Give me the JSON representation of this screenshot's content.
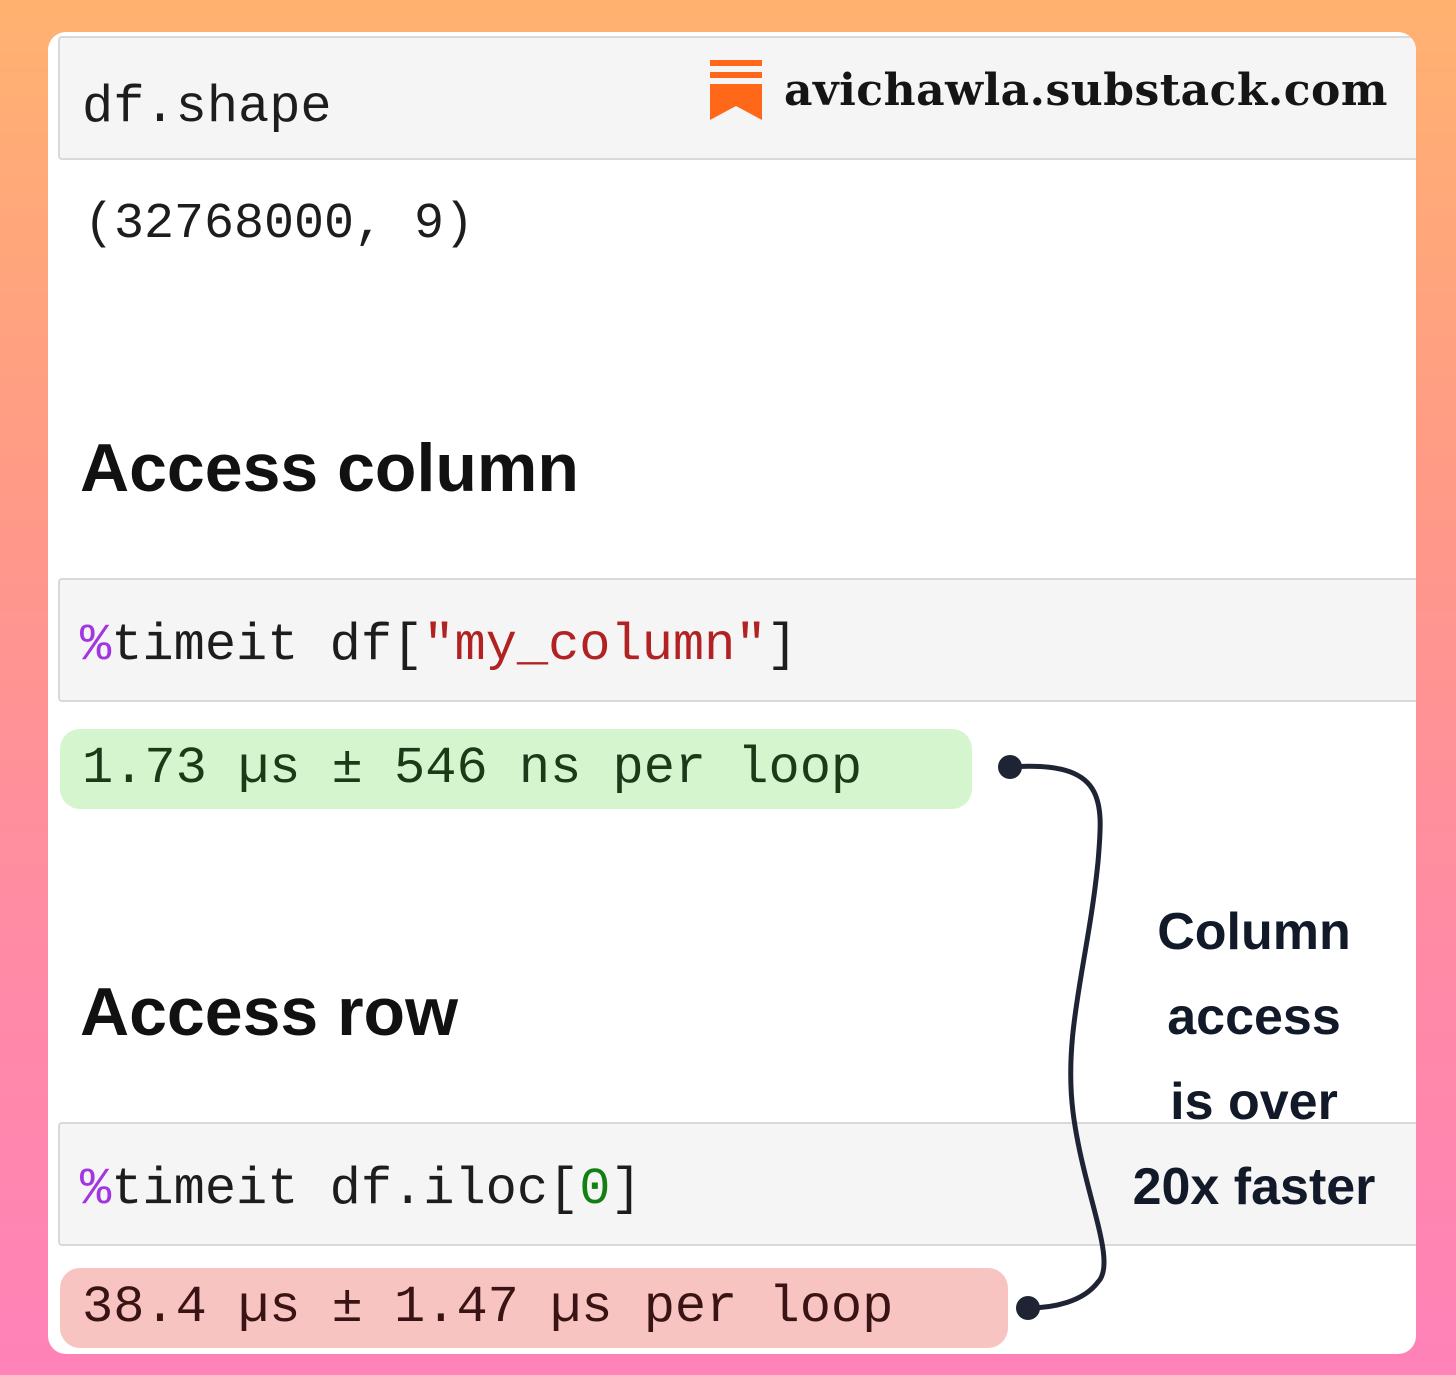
{
  "brand": {
    "site": "avichawla.substack.com",
    "logo_icon": "substack-bookmark-icon",
    "logo_color": "#ff6719"
  },
  "cells": {
    "shape_cell": {
      "code": "df.shape"
    },
    "shape_output": "(32768000, 9)",
    "column_section": {
      "heading": "Access column",
      "magic": "%",
      "code_prefix": "timeit df[",
      "string_literal": "\"my_column\"",
      "code_suffix": "]",
      "result": "1.73 µs ± 546 ns per loop"
    },
    "row_section": {
      "heading": "Access row",
      "magic": "%",
      "code_prefix": "timeit df.iloc[",
      "number_literal": "0",
      "code_suffix": "]",
      "result": "38.4 µs ± 1.47 µs per loop"
    }
  },
  "annotation": {
    "lines": [
      "Column",
      "access",
      "is over",
      "20x faster"
    ]
  },
  "colors": {
    "fast_bg": "#d5f5cf",
    "slow_bg": "#f8c4c2",
    "magic": "#a336e0",
    "string": "#b22222",
    "number": "#138013"
  }
}
